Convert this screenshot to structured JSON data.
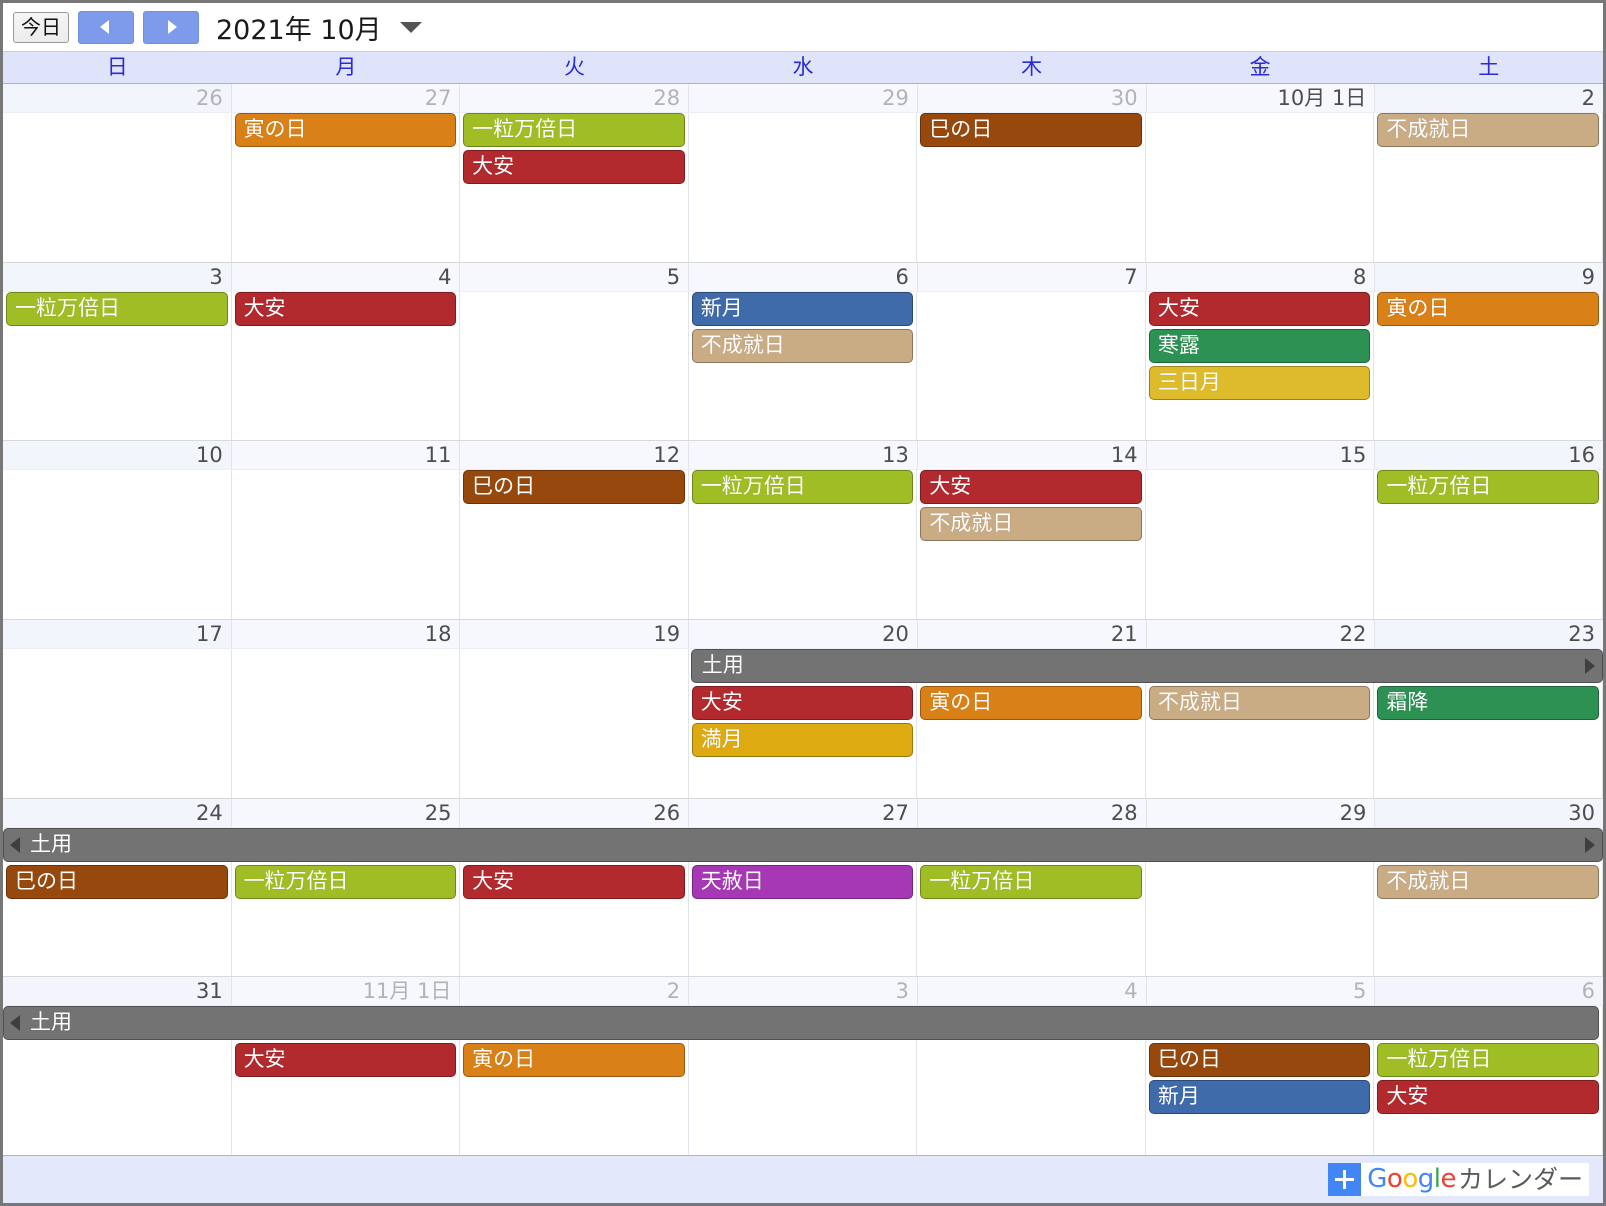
{
  "toolbar": {
    "today_label": "今日",
    "prev_label": "◀",
    "next_label": "▶",
    "period_label": "2021年 10月",
    "dropdown_icon": "chevron-down-icon"
  },
  "weekdays": [
    "日",
    "月",
    "火",
    "水",
    "木",
    "金",
    "土"
  ],
  "colors": {
    "event_green": "#9fbe25",
    "event_red": "#b2292e",
    "event_orange": "#d98016",
    "event_brown": "#97480d",
    "event_tan": "#c9ab84",
    "event_blue": "#3f6bab",
    "event_teal": "#2c9153",
    "event_gold": "#ddbb2b",
    "event_purple": "#a637b5",
    "event_gray": "#737373",
    "header_bg": "#dfe4fb",
    "weekday_text": "#2b2bd4",
    "footer_bg": "#e4e8fb"
  },
  "weeks": [
    {
      "days": [
        {
          "num": "26",
          "other": true
        },
        {
          "num": "27",
          "other": true
        },
        {
          "num": "28",
          "other": true
        },
        {
          "num": "29",
          "other": true
        },
        {
          "num": "30",
          "other": true
        },
        {
          "num": "10月 1日",
          "other": false
        },
        {
          "num": "2",
          "other": false
        }
      ],
      "events": [
        {
          "title": "寅の日",
          "col": 1,
          "span": 1,
          "row": 0,
          "color": "#d98016"
        },
        {
          "title": "一粒万倍日",
          "col": 2,
          "span": 1,
          "row": 0,
          "color": "#9fbe25"
        },
        {
          "title": "大安",
          "col": 2,
          "span": 1,
          "row": 1,
          "color": "#b2292e"
        },
        {
          "title": "巳の日",
          "col": 4,
          "span": 1,
          "row": 0,
          "color": "#97480d"
        },
        {
          "title": "不成就日",
          "col": 6,
          "span": 1,
          "row": 0,
          "color": "#c9ab84"
        }
      ]
    },
    {
      "days": [
        {
          "num": "3",
          "other": false
        },
        {
          "num": "4",
          "other": false
        },
        {
          "num": "5",
          "other": false
        },
        {
          "num": "6",
          "other": false
        },
        {
          "num": "7",
          "other": false
        },
        {
          "num": "8",
          "other": false
        },
        {
          "num": "9",
          "other": false
        }
      ],
      "events": [
        {
          "title": "一粒万倍日",
          "col": 0,
          "span": 1,
          "row": 0,
          "color": "#9fbe25"
        },
        {
          "title": "大安",
          "col": 1,
          "span": 1,
          "row": 0,
          "color": "#b2292e"
        },
        {
          "title": "新月",
          "col": 3,
          "span": 1,
          "row": 0,
          "color": "#3f6bab"
        },
        {
          "title": "不成就日",
          "col": 3,
          "span": 1,
          "row": 1,
          "color": "#c9ab84"
        },
        {
          "title": "大安",
          "col": 5,
          "span": 1,
          "row": 0,
          "color": "#b2292e"
        },
        {
          "title": "寒露",
          "col": 5,
          "span": 1,
          "row": 1,
          "color": "#2c9153"
        },
        {
          "title": "三日月",
          "col": 5,
          "span": 1,
          "row": 2,
          "color": "#ddbb2b"
        },
        {
          "title": "寅の日",
          "col": 6,
          "span": 1,
          "row": 0,
          "color": "#d98016"
        }
      ]
    },
    {
      "days": [
        {
          "num": "10",
          "other": false
        },
        {
          "num": "11",
          "other": false
        },
        {
          "num": "12",
          "other": false
        },
        {
          "num": "13",
          "other": false
        },
        {
          "num": "14",
          "other": false
        },
        {
          "num": "15",
          "other": false
        },
        {
          "num": "16",
          "other": false
        }
      ],
      "events": [
        {
          "title": "巳の日",
          "col": 2,
          "span": 1,
          "row": 0,
          "color": "#97480d"
        },
        {
          "title": "一粒万倍日",
          "col": 3,
          "span": 1,
          "row": 0,
          "color": "#9fbe25"
        },
        {
          "title": "大安",
          "col": 4,
          "span": 1,
          "row": 0,
          "color": "#b2292e"
        },
        {
          "title": "不成就日",
          "col": 4,
          "span": 1,
          "row": 1,
          "color": "#c9ab84"
        },
        {
          "title": "一粒万倍日",
          "col": 6,
          "span": 1,
          "row": 0,
          "color": "#9fbe25"
        }
      ]
    },
    {
      "days": [
        {
          "num": "17",
          "other": false
        },
        {
          "num": "18",
          "other": false
        },
        {
          "num": "19",
          "other": false
        },
        {
          "num": "20",
          "other": false
        },
        {
          "num": "21",
          "other": false
        },
        {
          "num": "22",
          "other": false
        },
        {
          "num": "23",
          "other": false
        }
      ],
      "events": [
        {
          "title": "土用",
          "col": 3,
          "span": 4,
          "row": 0,
          "color": "#737373",
          "multiday": true,
          "cont_right": true
        },
        {
          "title": "大安",
          "col": 3,
          "span": 1,
          "row": 1,
          "color": "#b2292e"
        },
        {
          "title": "満月",
          "col": 3,
          "span": 1,
          "row": 2,
          "color": "#ddaa11"
        },
        {
          "title": "寅の日",
          "col": 4,
          "span": 1,
          "row": 1,
          "color": "#d98016"
        },
        {
          "title": "不成就日",
          "col": 5,
          "span": 1,
          "row": 1,
          "color": "#c9ab84"
        },
        {
          "title": "霜降",
          "col": 6,
          "span": 1,
          "row": 1,
          "color": "#2c9153"
        }
      ]
    },
    {
      "days": [
        {
          "num": "24",
          "other": false
        },
        {
          "num": "25",
          "other": false
        },
        {
          "num": "26",
          "other": false
        },
        {
          "num": "27",
          "other": false
        },
        {
          "num": "28",
          "other": false
        },
        {
          "num": "29",
          "other": false
        },
        {
          "num": "30",
          "other": false
        }
      ],
      "events": [
        {
          "title": "土用",
          "col": 0,
          "span": 7,
          "row": 0,
          "color": "#737373",
          "multiday": true,
          "cont_left": true,
          "cont_right": true
        },
        {
          "title": "巳の日",
          "col": 0,
          "span": 1,
          "row": 1,
          "color": "#97480d"
        },
        {
          "title": "一粒万倍日",
          "col": 1,
          "span": 1,
          "row": 1,
          "color": "#9fbe25"
        },
        {
          "title": "大安",
          "col": 2,
          "span": 1,
          "row": 1,
          "color": "#b2292e"
        },
        {
          "title": "天赦日",
          "col": 3,
          "span": 1,
          "row": 1,
          "color": "#a637b5"
        },
        {
          "title": "一粒万倍日",
          "col": 4,
          "span": 1,
          "row": 1,
          "color": "#9fbe25"
        },
        {
          "title": "不成就日",
          "col": 6,
          "span": 1,
          "row": 1,
          "color": "#c9ab84"
        }
      ]
    },
    {
      "days": [
        {
          "num": "31",
          "other": false
        },
        {
          "num": "11月 1日",
          "other": true
        },
        {
          "num": "2",
          "other": true
        },
        {
          "num": "3",
          "other": true
        },
        {
          "num": "4",
          "other": true
        },
        {
          "num": "5",
          "other": true
        },
        {
          "num": "6",
          "other": true
        }
      ],
      "events": [
        {
          "title": "土用",
          "col": 0,
          "span": 7,
          "row": 0,
          "color": "#737373",
          "multiday": true,
          "cont_left": true
        },
        {
          "title": "大安",
          "col": 1,
          "span": 1,
          "row": 1,
          "color": "#b2292e"
        },
        {
          "title": "寅の日",
          "col": 2,
          "span": 1,
          "row": 1,
          "color": "#d98016"
        },
        {
          "title": "巳の日",
          "col": 5,
          "span": 1,
          "row": 1,
          "color": "#97480d"
        },
        {
          "title": "新月",
          "col": 5,
          "span": 1,
          "row": 2,
          "color": "#3f6bab"
        },
        {
          "title": "一粒万倍日",
          "col": 6,
          "span": 1,
          "row": 1,
          "color": "#9fbe25"
        },
        {
          "title": "大安",
          "col": 6,
          "span": 1,
          "row": 2,
          "color": "#b2292e"
        }
      ]
    }
  ],
  "footer": {
    "add_icon": "plus-icon",
    "logo_letters": [
      "G",
      "o",
      "o",
      "g",
      "l",
      "e"
    ],
    "logo_text": "Google",
    "kana_text": "カレンダー"
  }
}
